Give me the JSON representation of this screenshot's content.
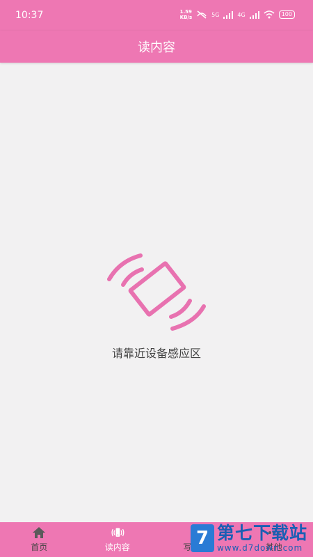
{
  "status_bar": {
    "time": "10:37",
    "speed_value": "1.59",
    "speed_unit": "KB/s",
    "net1": "5G",
    "net2": "4G",
    "battery": "100"
  },
  "app_bar": {
    "title": "读内容"
  },
  "main": {
    "hint": "请靠近设备感应区",
    "icon": "nfc-phone-icon"
  },
  "bottom_nav": {
    "items": [
      {
        "label": "首页",
        "icon": "home-icon"
      },
      {
        "label": "读内容",
        "icon": "nfc-read-icon",
        "active": true
      },
      {
        "label": "写内容",
        "icon": "edit-icon"
      },
      {
        "label": "其他",
        "icon": "more-icon"
      }
    ]
  },
  "watermark": {
    "title": "第七下载站",
    "url": "www.d7down.com",
    "logo_letter": "7"
  },
  "colors": {
    "accent": "#ee77b3",
    "background": "#f2f1f2",
    "text": "#444444",
    "watermark": "#1a5fb4"
  }
}
